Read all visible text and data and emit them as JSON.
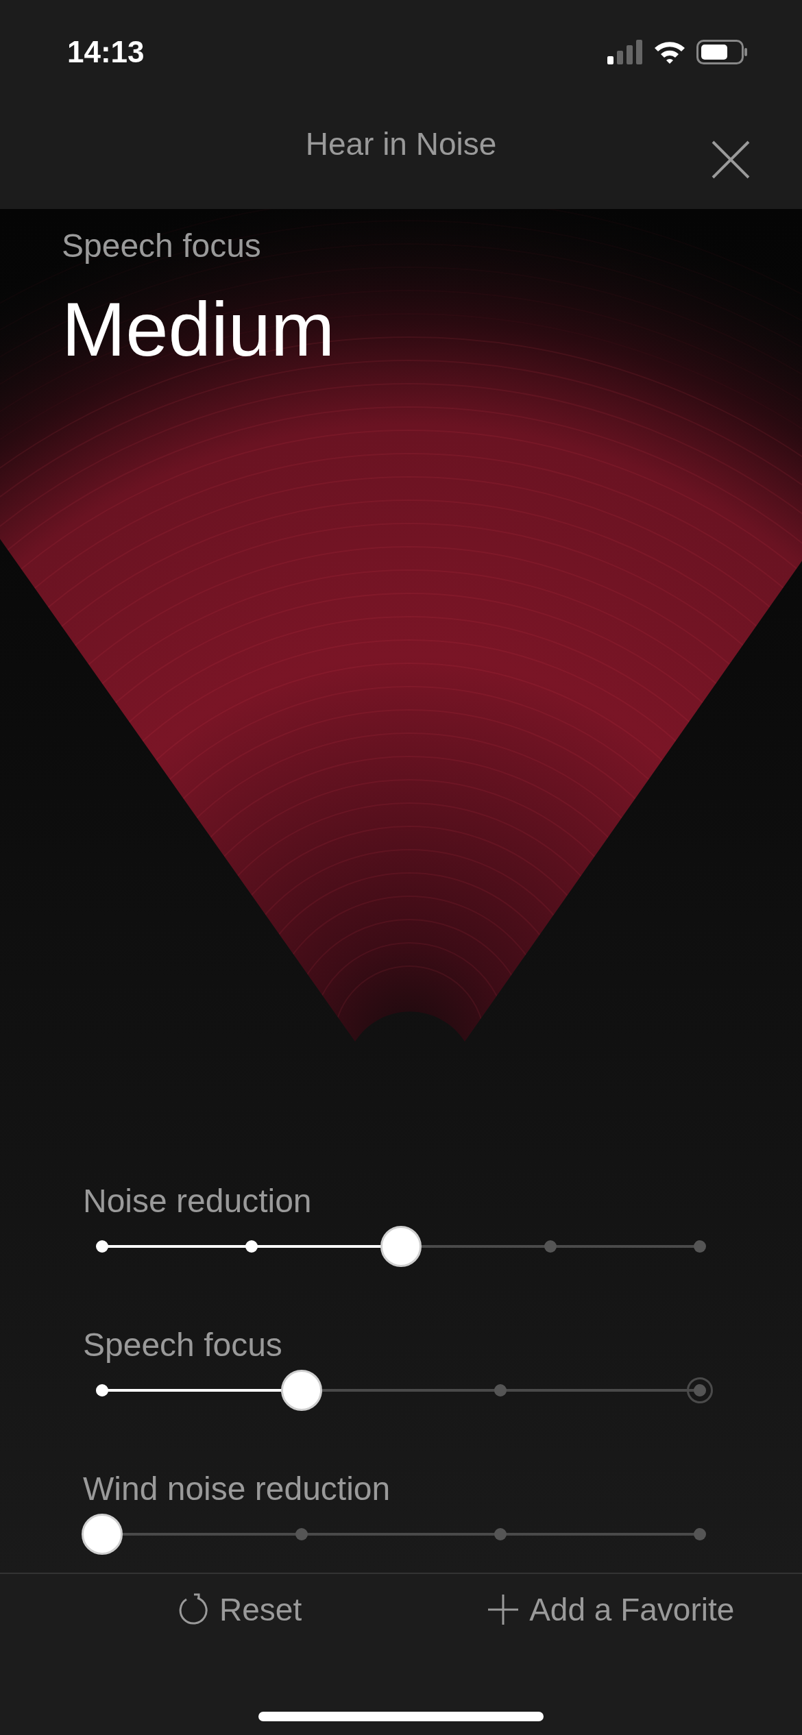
{
  "status_bar": {
    "time": "14:13"
  },
  "header": {
    "title": "Hear in Noise"
  },
  "focus": {
    "label": "Speech focus",
    "value": "Medium"
  },
  "sliders": [
    {
      "label": "Noise reduction",
      "level": 0.5,
      "stops": [
        {
          "kind": "dot"
        },
        {
          "kind": "dot"
        },
        {
          "kind": "thumb"
        },
        {
          "kind": "dot"
        },
        {
          "kind": "dot"
        }
      ]
    },
    {
      "label": "Speech focus",
      "level": 0.3333,
      "stops": [
        {
          "kind": "dot"
        },
        {
          "kind": "thumb"
        },
        {
          "kind": "dot"
        },
        {
          "kind": "ring"
        }
      ]
    },
    {
      "label": "Wind noise reduction",
      "level": 0,
      "stops": [
        {
          "kind": "thumb"
        },
        {
          "kind": "dot"
        },
        {
          "kind": "dot"
        },
        {
          "kind": "dot"
        }
      ]
    }
  ],
  "actions": [
    {
      "kind": "reset",
      "label": "Reset"
    },
    {
      "kind": "add",
      "label": "Add a Favorite"
    }
  ]
}
